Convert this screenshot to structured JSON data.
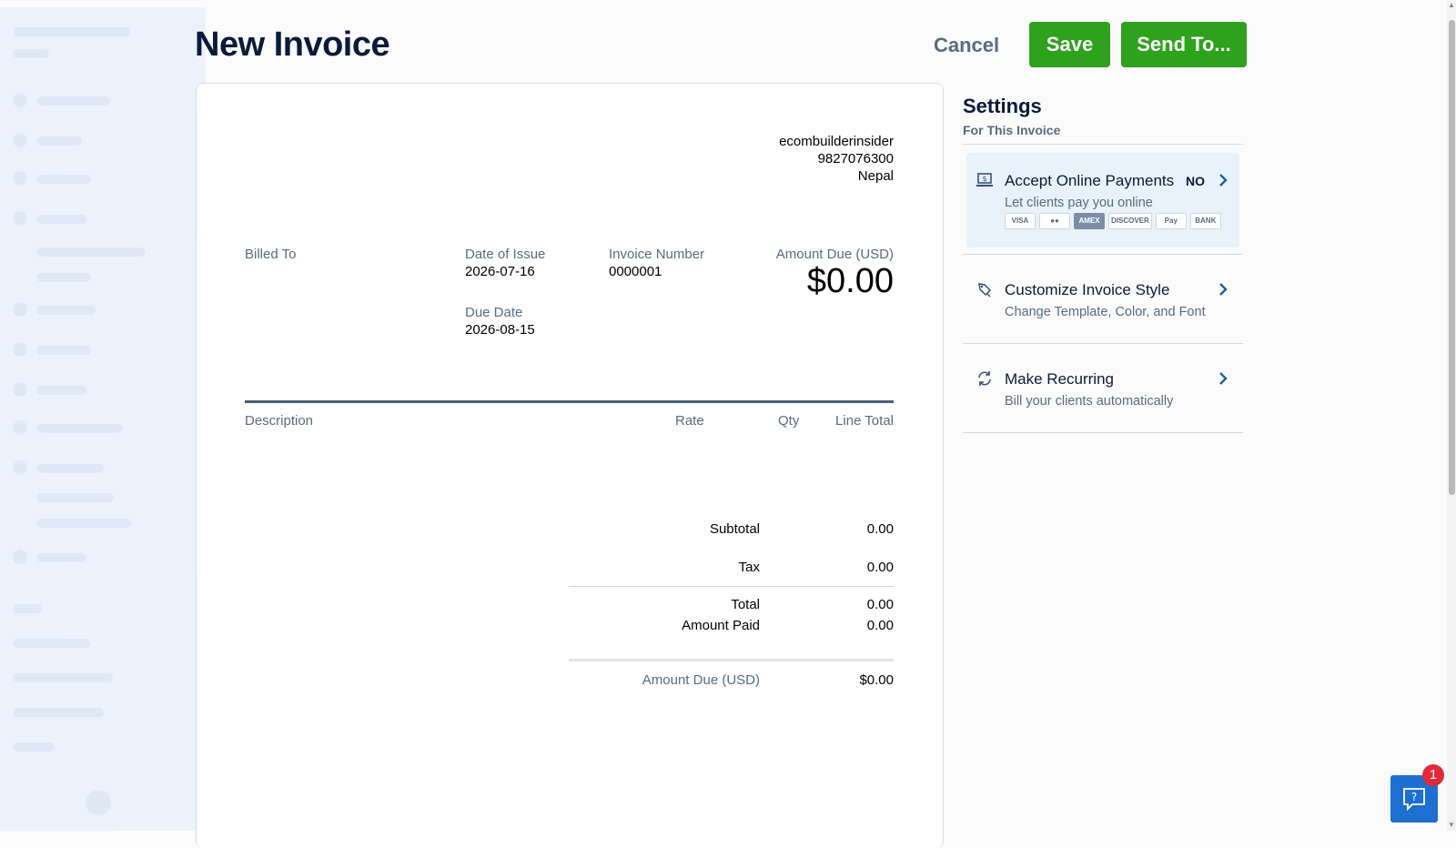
{
  "header": {
    "title": "New Invoice",
    "cancel_label": "Cancel",
    "save_label": "Save",
    "send_label": "Send To..."
  },
  "invoice": {
    "company": {
      "name": "ecombuilderinsider",
      "phone": "9827076300",
      "country": "Nepal"
    },
    "billed_to_label": "Billed To",
    "date_of_issue_label": "Date of Issue",
    "date_of_issue": "2026-07-16",
    "due_date_label": "Due Date",
    "due_date": "2026-08-15",
    "invoice_number_label": "Invoice Number",
    "invoice_number": "0000001",
    "amount_due_label": "Amount Due (USD)",
    "amount_due": "$0.00",
    "columns": [
      "Description",
      "Rate",
      "Qty",
      "Line Total"
    ],
    "totals": {
      "subtotal_label": "Subtotal",
      "subtotal": "0.00",
      "tax_label": "Tax",
      "tax": "0.00",
      "total_label": "Total",
      "total": "0.00",
      "amount_paid_label": "Amount Paid",
      "amount_paid": "0.00",
      "amount_due_label": "Amount Due (USD)",
      "amount_due": "$0.00"
    }
  },
  "settings": {
    "title": "Settings",
    "subtitle": "For This Invoice",
    "items": [
      {
        "title": "Accept Online Payments",
        "desc": "Let clients pay you online",
        "status": "NO",
        "icon": "laptop-dollar-icon",
        "card_logos": [
          "VISA",
          "●●",
          "AMEX",
          "DISCOVER",
          "Pay",
          "BANK"
        ]
      },
      {
        "title": "Customize Invoice Style",
        "desc": "Change Template, Color, and Font",
        "icon": "brush-icon"
      },
      {
        "title": "Make Recurring",
        "desc": "Bill your clients automatically",
        "icon": "recurring-icon"
      }
    ]
  },
  "help": {
    "badge_count": "1"
  },
  "colors": {
    "primary_green": "#2ea11d",
    "navy": "#0b1a3a",
    "muted": "#5a6b82",
    "link_blue": "#1b5fa8",
    "help_blue": "#1f6fd1",
    "badge_red": "#e02a3a"
  }
}
